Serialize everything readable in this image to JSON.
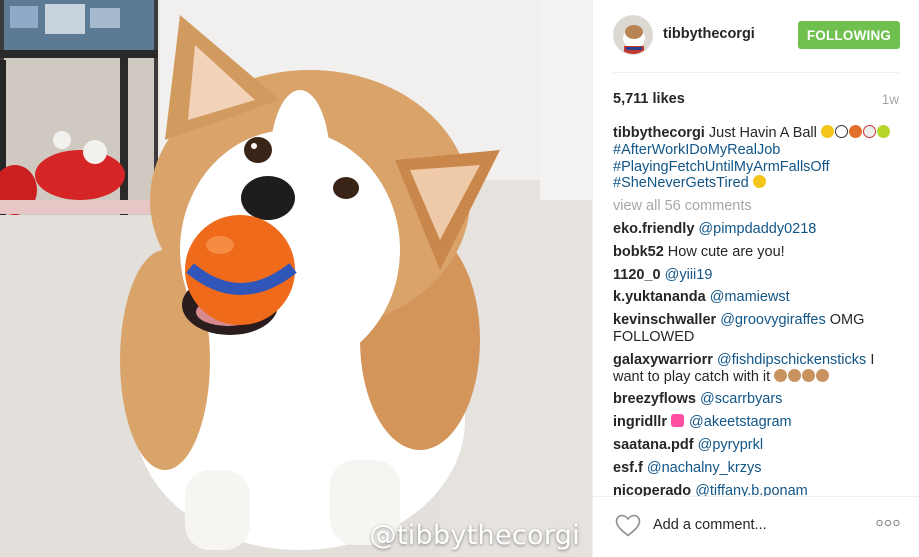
{
  "post": {
    "watermark": "@tibbythecorgi"
  },
  "header": {
    "username": "tibbythecorgi",
    "follow_label": "FOLLOWING",
    "follow_color": "#70c050"
  },
  "stats": {
    "likes": "5,711 likes",
    "time": "1w"
  },
  "caption": {
    "username": "tibbythecorgi",
    "text": "Just Havin A Ball",
    "hashtags": [
      "#AfterWorkIDoMyRealJob",
      "#PlayingFetchUntilMyArmFallsOff",
      "#SheNeverGetsTired"
    ]
  },
  "view_all": "view all 56 comments",
  "comments": [
    {
      "user": "eko.friendly",
      "mention": "@pimpdaddy0218",
      "text": ""
    },
    {
      "user": "bobk52",
      "mention": "",
      "text": "How cute are you!"
    },
    {
      "user": "1120_0",
      "mention": "@yiii19",
      "text": ""
    },
    {
      "user": "k.yuktananda",
      "mention": "@mamiewst",
      "text": ""
    },
    {
      "user": "kevinschwaller",
      "mention": "@groovygiraffes",
      "text": "OMG FOLLOWED"
    },
    {
      "user": "galaxywarriorr",
      "mention": "@fishdipschickensticks",
      "text": "I want to play catch with it"
    },
    {
      "user": "breezyflows",
      "mention": "@scarrbyars",
      "text": ""
    },
    {
      "user": "ingridllr",
      "mention": "@akeetstagram",
      "text": ""
    },
    {
      "user": "saatana.pdf",
      "mention": "@pyryprkl",
      "text": ""
    },
    {
      "user": "esf.f",
      "mention": "@nachalny_krzys",
      "text": ""
    },
    {
      "user": "nicoperado",
      "mention": "@tiffany.b.ponam",
      "text": ""
    }
  ],
  "footer": {
    "add_comment_placeholder": "Add a comment...",
    "heart_icon": "heart-outline-icon",
    "more_icon": "more-dots-icon"
  },
  "colors": {
    "link": "#125688",
    "muted": "#a5a7aa",
    "text": "#262626"
  }
}
